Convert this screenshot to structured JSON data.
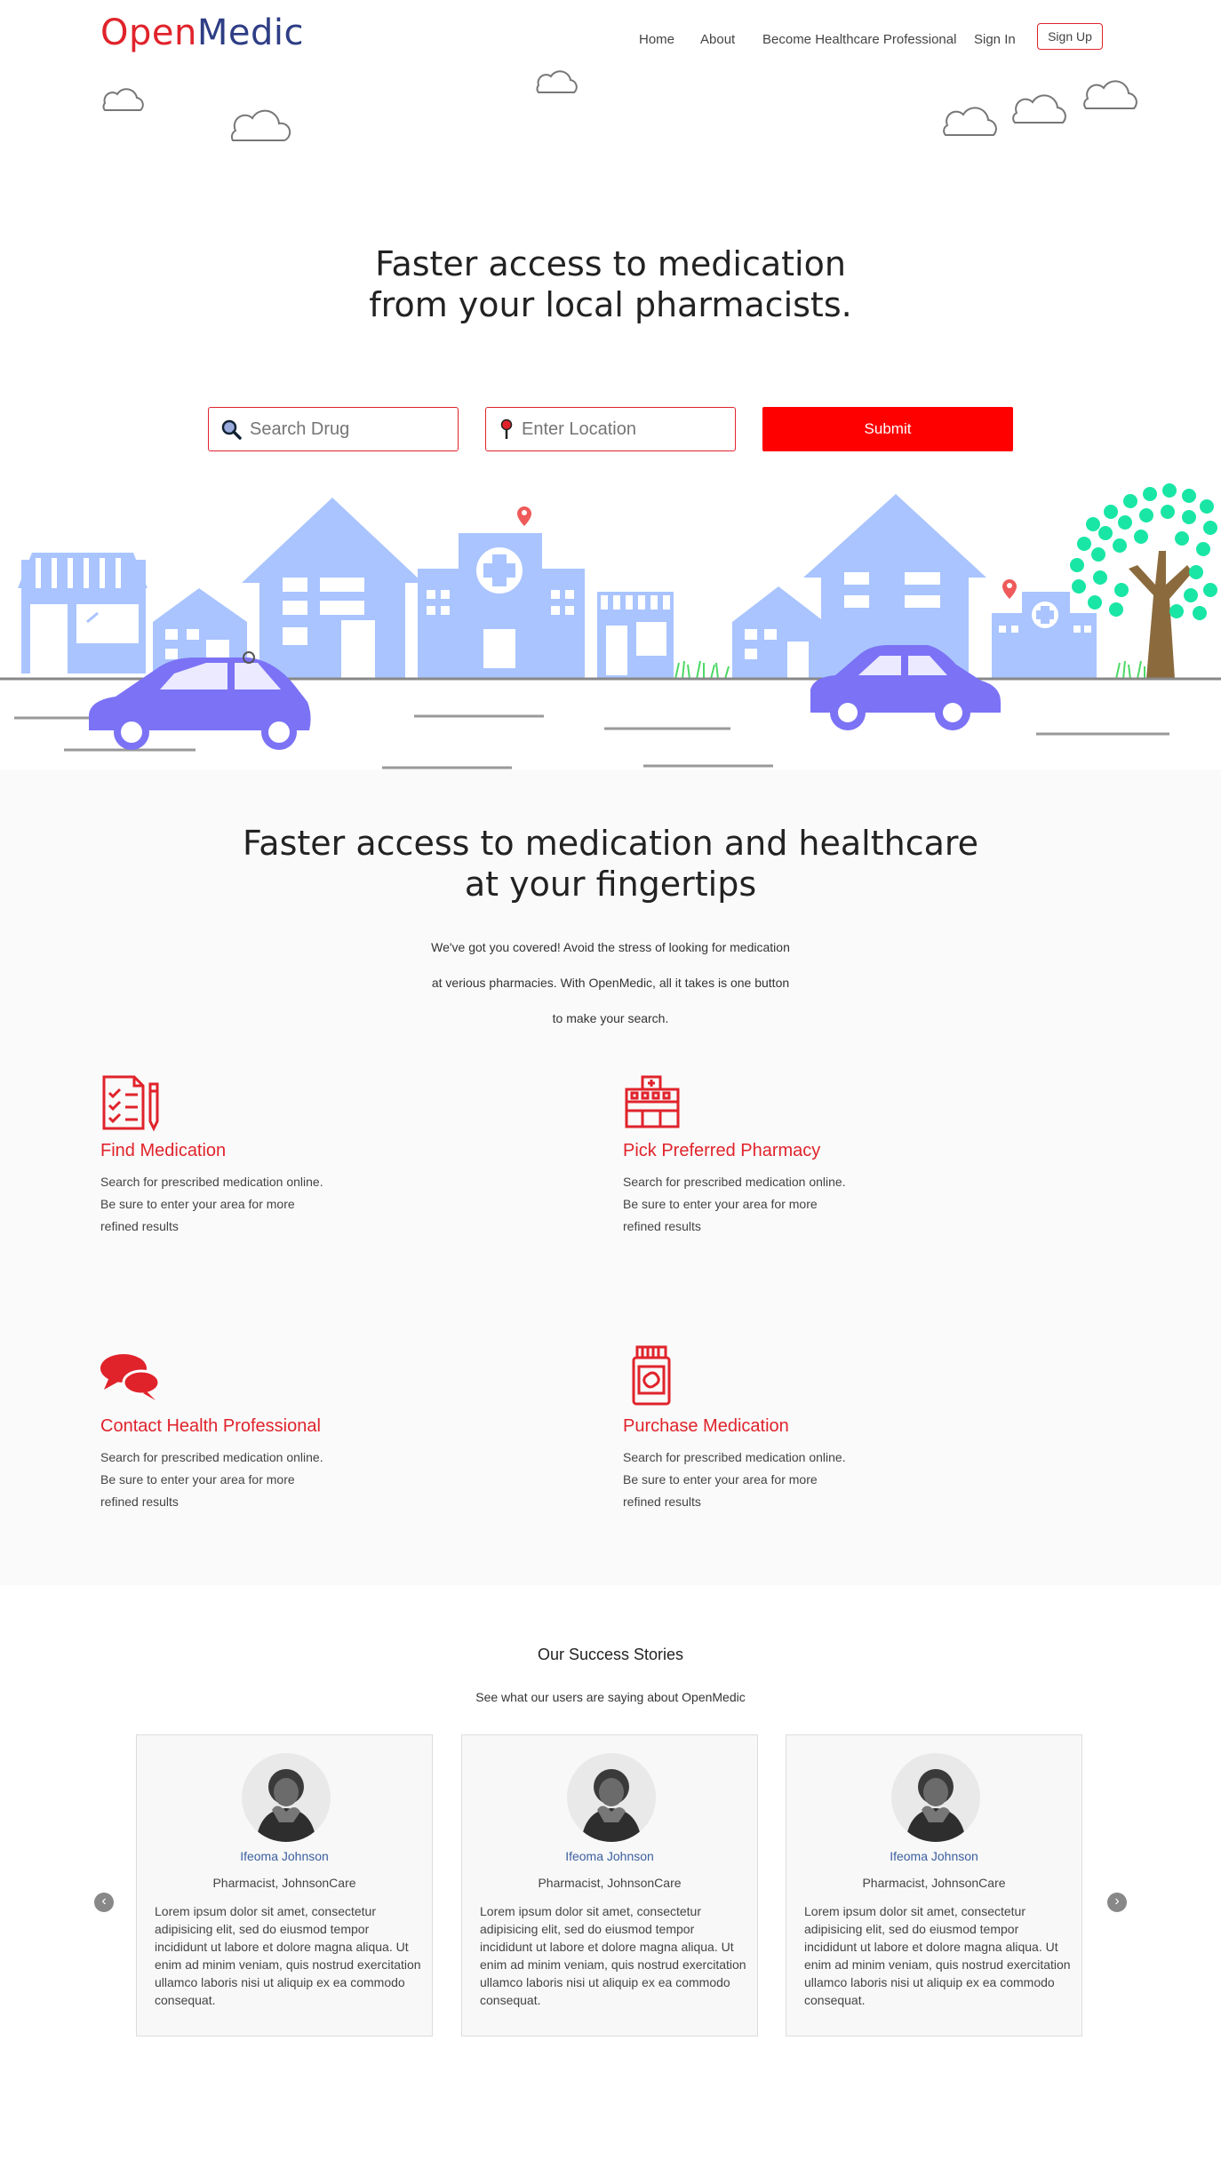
{
  "brand": {
    "part1": "Open",
    "part2": "Medic"
  },
  "nav": {
    "home": "Home",
    "about": "About",
    "become": "Become Healthcare Professional",
    "signin": "Sign In",
    "signup": "Sign Up"
  },
  "hero": {
    "line1": "Faster access to medication",
    "line2": "from your local pharmacists.",
    "drug_placeholder": "Search Drug",
    "location_placeholder": "Enter Location",
    "submit": "Submit"
  },
  "features": {
    "title1": "Faster access to medication and healthcare",
    "title2": "at your fingertips",
    "desc1": "We've got you covered! Avoid the stress of looking for medication",
    "desc2": "at verious pharmacies. With OpenMedic, all it takes is one button",
    "desc3": "to make your search.",
    "items": [
      {
        "title": "Find Medication",
        "l1": "Search for prescribed medication online.",
        "l2": "Be sure to enter your area for more",
        "l3": "refined results",
        "icon": "checklist-icon"
      },
      {
        "title": "Pick Preferred Pharmacy",
        "l1": "Search for prescribed medication online.",
        "l2": "Be sure to enter your area for more",
        "l3": "refined results",
        "icon": "pharmacy-building-icon"
      },
      {
        "title": "Contact Health Professional",
        "l1": "Search for prescribed medication online.",
        "l2": "Be sure to enter your area for more",
        "l3": "refined results",
        "icon": "chat-bubbles-icon"
      },
      {
        "title": "Purchase Medication",
        "l1": "Search for prescribed medication online.",
        "l2": "Be sure to enter your area for more",
        "l3": "refined results",
        "icon": "medicine-bottle-icon"
      }
    ]
  },
  "stories": {
    "title": "Our Success Stories",
    "subtitle": "See what our users are saying about OpenMedic",
    "cards": [
      {
        "name": "Ifeoma Johnson",
        "role": "Pharmacist, JohnsonCare",
        "text": "Lorem ipsum dolor sit amet, consectetur adipisicing elit, sed do eiusmod tempor incididunt ut labore et dolore magna aliqua. Ut enim ad minim veniam, quis nostrud exercitation ullamco laboris nisi ut aliquip ex ea commodo consequat."
      },
      {
        "name": "Ifeoma Johnson",
        "role": "Pharmacist, JohnsonCare",
        "text": "Lorem ipsum dolor sit amet, consectetur adipisicing elit, sed do eiusmod tempor incididunt ut labore et dolore magna aliqua. Ut enim ad minim veniam, quis nostrud exercitation ullamco laboris nisi ut aliquip ex ea commodo consequat."
      },
      {
        "name": "Ifeoma Johnson",
        "role": "Pharmacist, JohnsonCare",
        "text": "Lorem ipsum dolor sit amet, consectetur adipisicing elit, sed do eiusmod tempor incididunt ut labore et dolore magna aliqua. Ut enim ad minim veniam, quis nostrud exercitation ullamco laboris nisi ut aliquip ex ea commodo consequat."
      }
    ],
    "prev": "‹",
    "next": "›"
  },
  "colors": {
    "brand_red": "#e0232b",
    "brand_blue": "#2e3e85",
    "submit_red": "#ff0000",
    "building_blue": "#a9c4ff",
    "car_purple": "#7b72f5",
    "tree_green": "#19e6a5"
  }
}
